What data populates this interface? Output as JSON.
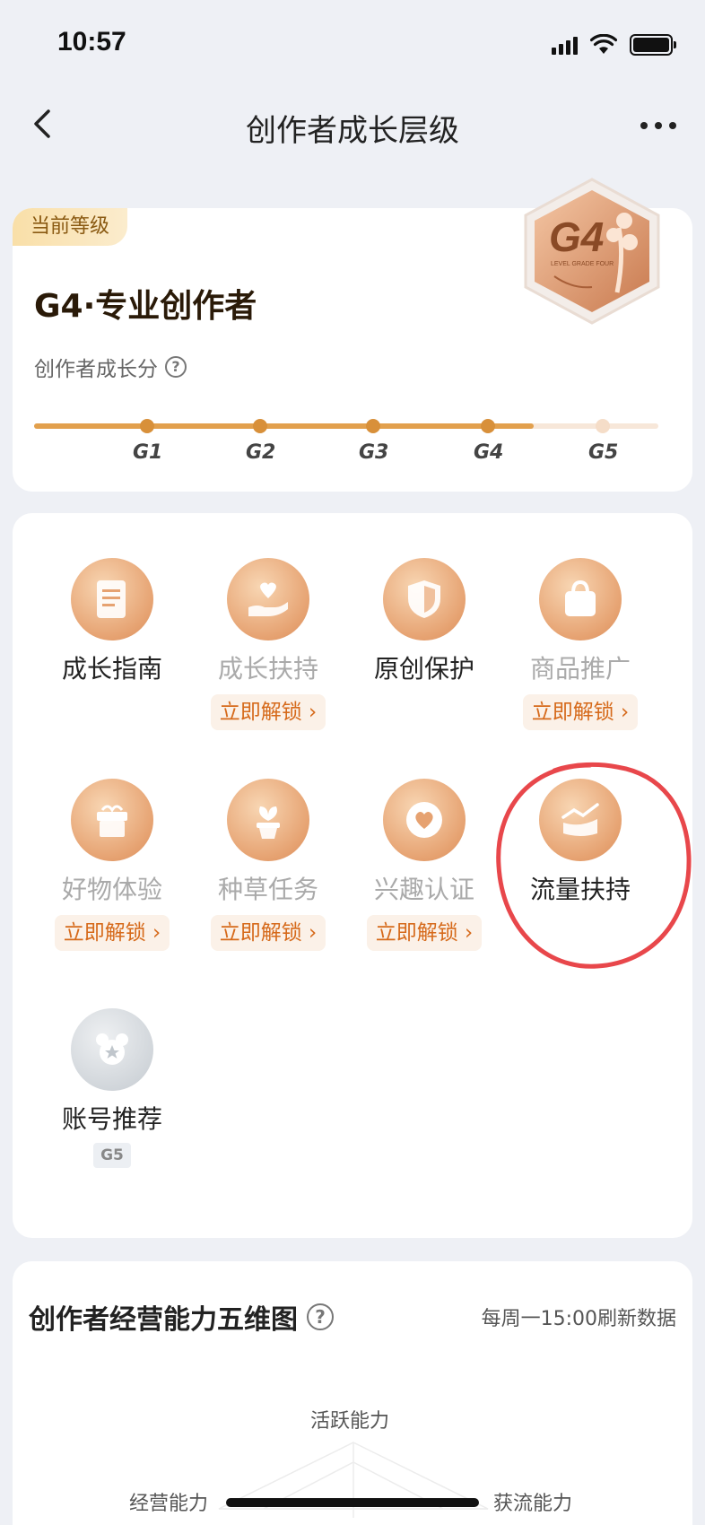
{
  "status_bar": {
    "time": "10:57"
  },
  "nav": {
    "title": "创作者成长层级"
  },
  "level": {
    "tag": "当前等级",
    "title": "G4·专业创作者",
    "score_label": "创作者成长分",
    "progress_fraction": 0.8,
    "ticks": [
      "G1",
      "G2",
      "G3",
      "G4",
      "G5"
    ],
    "badge_text": "G4",
    "badge_sub": "LEVEL GRADE FOUR"
  },
  "functions": [
    {
      "name": "成长指南",
      "unlock": ""
    },
    {
      "name": "成长扶持",
      "unlock": "立即解锁 ›"
    },
    {
      "name": "原创保护",
      "unlock": ""
    },
    {
      "name": "商品推广",
      "unlock": "立即解锁 ›"
    },
    {
      "name": "好物体验",
      "unlock": "立即解锁 ›"
    },
    {
      "name": "种草任务",
      "unlock": "立即解锁 ›"
    },
    {
      "name": "兴趣认证",
      "unlock": "立即解锁 ›"
    },
    {
      "name": "流量扶持",
      "unlock": ""
    },
    {
      "name": "账号推荐",
      "tag": "G5"
    }
  ],
  "five_dim": {
    "title": "创作者经营能力五维图",
    "refresh": "每周一15:00刷新数据",
    "axes": {
      "top": "活跃能力",
      "left": "经营能力",
      "right": "获流能力"
    }
  },
  "colors": {
    "accent": "#d66a1b",
    "progress": "#e2a04d",
    "annotation": "#e8474b"
  }
}
